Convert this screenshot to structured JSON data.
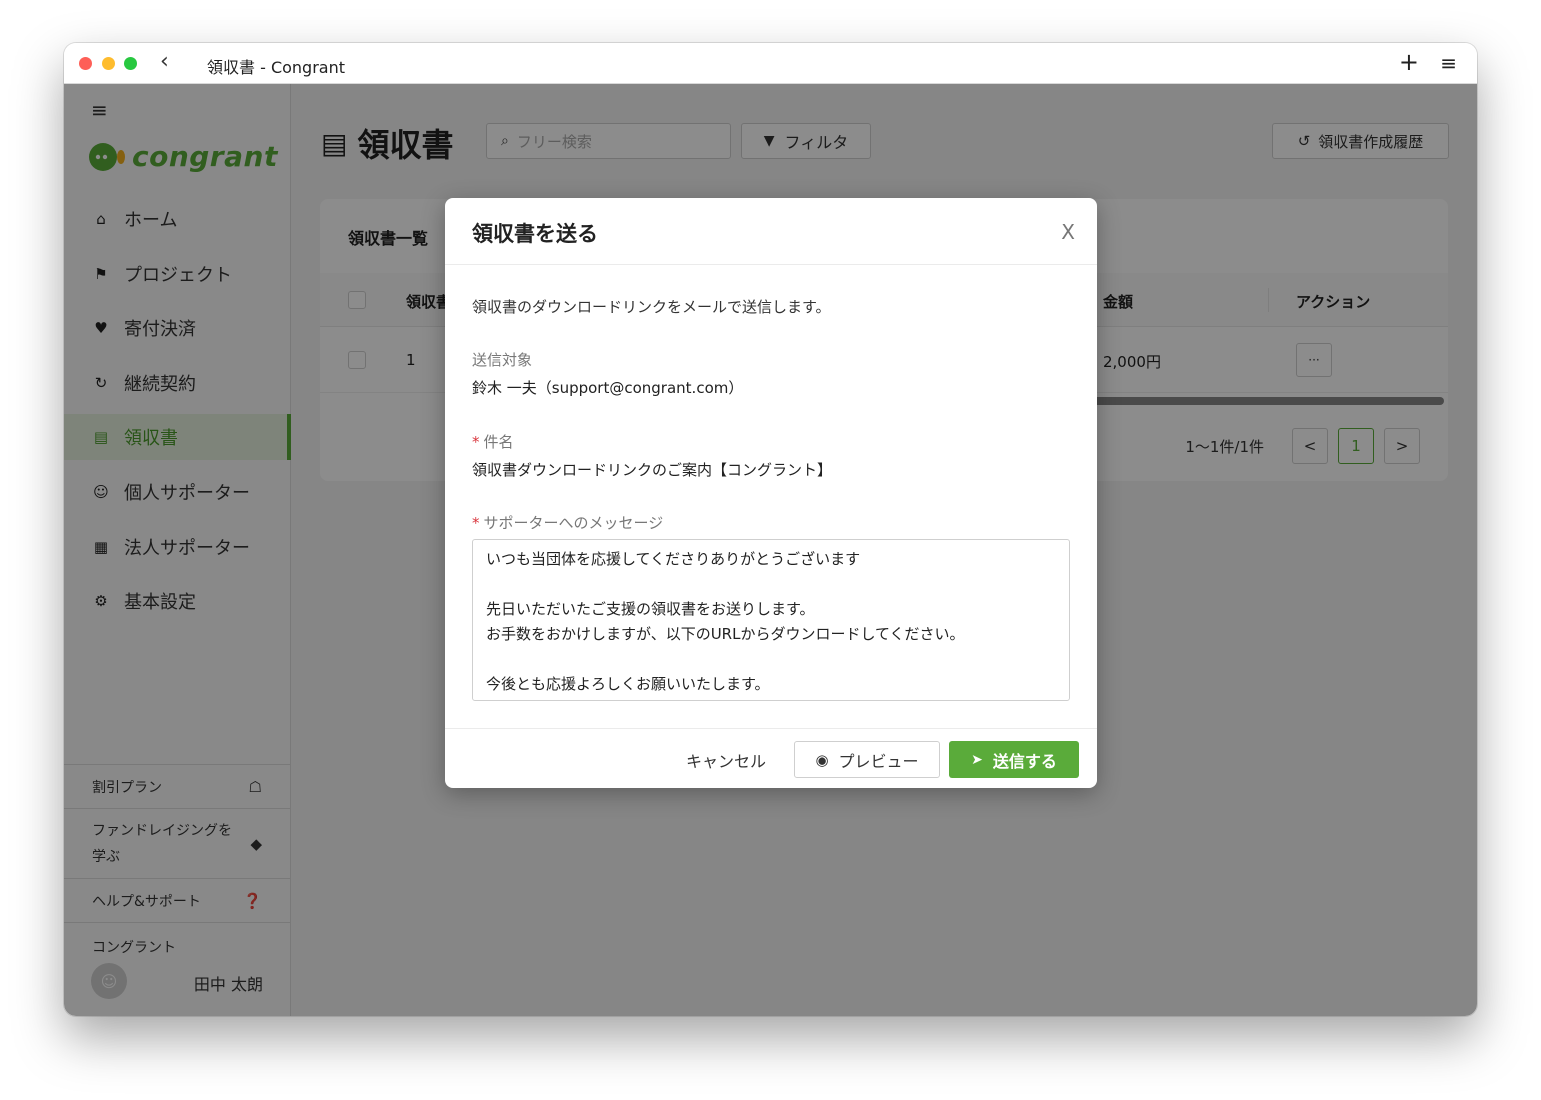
{
  "window": {
    "title": "領収書 - Congrant"
  },
  "colors": {
    "brand": "#5aab3a",
    "required": "#d9363e"
  },
  "sidebar": {
    "logo_text": "congrant",
    "items": [
      {
        "label": "ホーム",
        "icon": "home-icon",
        "active": false
      },
      {
        "label": "プロジェクト",
        "icon": "flag-icon",
        "active": false
      },
      {
        "label": "寄付決済",
        "icon": "heart-icon",
        "active": false
      },
      {
        "label": "継続契約",
        "icon": "refresh-icon",
        "active": false
      },
      {
        "label": "領収書",
        "icon": "list-icon",
        "active": true
      },
      {
        "label": "個人サポーター",
        "icon": "user-icon",
        "active": false
      },
      {
        "label": "法人サポーター",
        "icon": "building-icon",
        "active": false
      },
      {
        "label": "基本設定",
        "icon": "gear-icon",
        "active": false
      }
    ],
    "bottom": {
      "discount_plan": "割引プラン",
      "learn_fundraising": "ファンドレイジングを学ぶ",
      "help_support": "ヘルプ&サポート",
      "org_name": "コングラント",
      "user_name": "田中 太朗"
    }
  },
  "main": {
    "page_title": "領収書",
    "search_placeholder": "フリー検索",
    "filter_label": "フィルタ",
    "history_label": "領収書作成履歴",
    "card_title": "領収書一覧",
    "table": {
      "headers": {
        "number": "領収書",
        "amount": "金額",
        "action": "アクション"
      },
      "rows": [
        {
          "number": "1",
          "amount": "2,000円",
          "action": "···"
        }
      ]
    },
    "pagination": {
      "count": "1〜1件/1件",
      "prev": "<",
      "current": "1",
      "next": ">"
    }
  },
  "modal": {
    "title": "領収書を送る",
    "close": "X",
    "description": "領収書のダウンロードリンクをメールで送信します。",
    "target_label": "送信対象",
    "target_value": "鈴木 一夫（support@congrant.com）",
    "subject_label": "件名",
    "subject_value": "領収書ダウンロードリンクのご案内【コングラント】",
    "message_label": "サポーターへのメッセージ",
    "message_value": "いつも当団体を応援してくださりありがとうございます\n\n先日いただいたご支援の領収書をお送りします。\nお手数をおかけしますが、以下のURLからダウンロードしてください。\n\n今後とも応援よろしくお願いいたします。",
    "cancel_label": "キャンセル",
    "preview_label": "プレビュー",
    "send_label": "送信する"
  }
}
